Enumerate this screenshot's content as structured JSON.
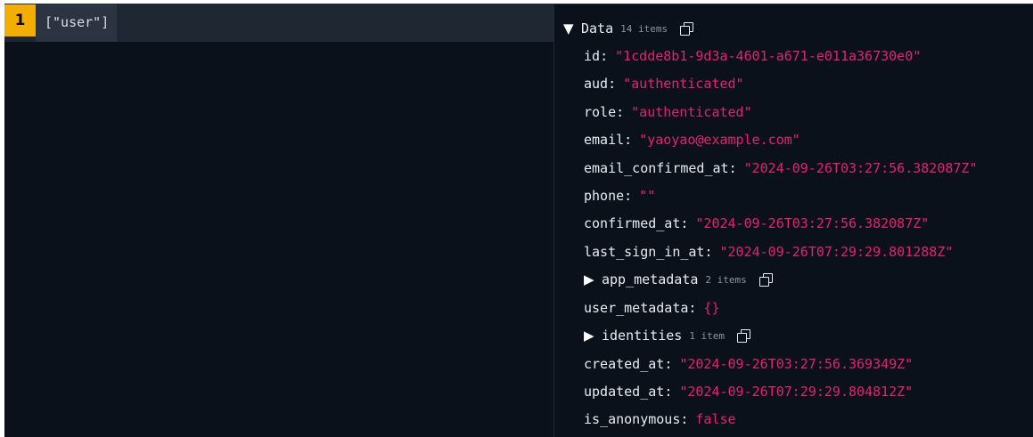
{
  "editor": {
    "line_number": "1",
    "code": "[\"user\"]"
  },
  "viewer": {
    "root": {
      "key": "Data",
      "count": "14 items"
    },
    "rows": [
      {
        "key": "id",
        "value": "\"1cdde8b1-9d3a-4601-a671-e011a36730e0\""
      },
      {
        "key": "aud",
        "value": "\"authenticated\""
      },
      {
        "key": "role",
        "value": "\"authenticated\""
      },
      {
        "key": "email",
        "value": "\"yaoyao@example.com\""
      },
      {
        "key": "email_confirmed_at",
        "value": "\"2024-09-26T03:27:56.382087Z\""
      },
      {
        "key": "phone",
        "value": "\"\""
      },
      {
        "key": "confirmed_at",
        "value": "\"2024-09-26T03:27:56.382087Z\""
      },
      {
        "key": "last_sign_in_at",
        "value": "\"2024-09-26T07:29:29.801288Z\""
      },
      {
        "key": "app_metadata",
        "count": "2 items"
      },
      {
        "key": "user_metadata",
        "value": "{}"
      },
      {
        "key": "identities",
        "count": "1 item"
      },
      {
        "key": "created_at",
        "value": "\"2024-09-26T03:27:56.369349Z\""
      },
      {
        "key": "updated_at",
        "value": "\"2024-09-26T07:29:29.804812Z\""
      },
      {
        "key": "is_anonymous",
        "value": "false"
      }
    ]
  },
  "colors": {
    "background": "#0b111b",
    "line_number_bg": "#f4ad05",
    "string_value": "#e0246f",
    "key_text": "#e8ecf1",
    "count_text": "#8a94a2"
  },
  "icons": {
    "expanded": "triangle-down-icon",
    "collapsed": "triangle-right-icon",
    "copy": "copy-icon"
  }
}
